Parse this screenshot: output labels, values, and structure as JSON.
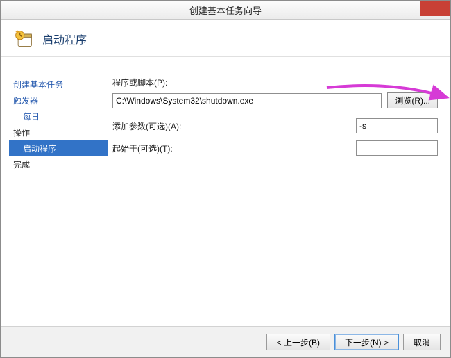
{
  "titlebar": {
    "text": "创建基本任务向导"
  },
  "header": {
    "title": "启动程序"
  },
  "sidebar": {
    "items": [
      {
        "label": "创建基本任务",
        "link": true,
        "indent": false,
        "selected": false
      },
      {
        "label": "触发器",
        "link": true,
        "indent": false,
        "selected": false
      },
      {
        "label": "每日",
        "link": true,
        "indent": true,
        "selected": false
      },
      {
        "label": "操作",
        "link": false,
        "indent": false,
        "selected": false
      },
      {
        "label": "启动程序",
        "link": false,
        "indent": true,
        "selected": true
      },
      {
        "label": "完成",
        "link": false,
        "indent": false,
        "selected": false
      }
    ]
  },
  "form": {
    "program_label": "程序或脚本(P):",
    "program_value": "C:\\Windows\\System32\\shutdown.exe",
    "browse_label": "浏览(R)...",
    "args_label": "添加参数(可选)(A):",
    "args_value": "-s",
    "startin_label": "起始于(可选)(T):",
    "startin_value": ""
  },
  "footer": {
    "back": "< 上一步(B)",
    "next": "下一步(N) >",
    "cancel": "取消"
  }
}
